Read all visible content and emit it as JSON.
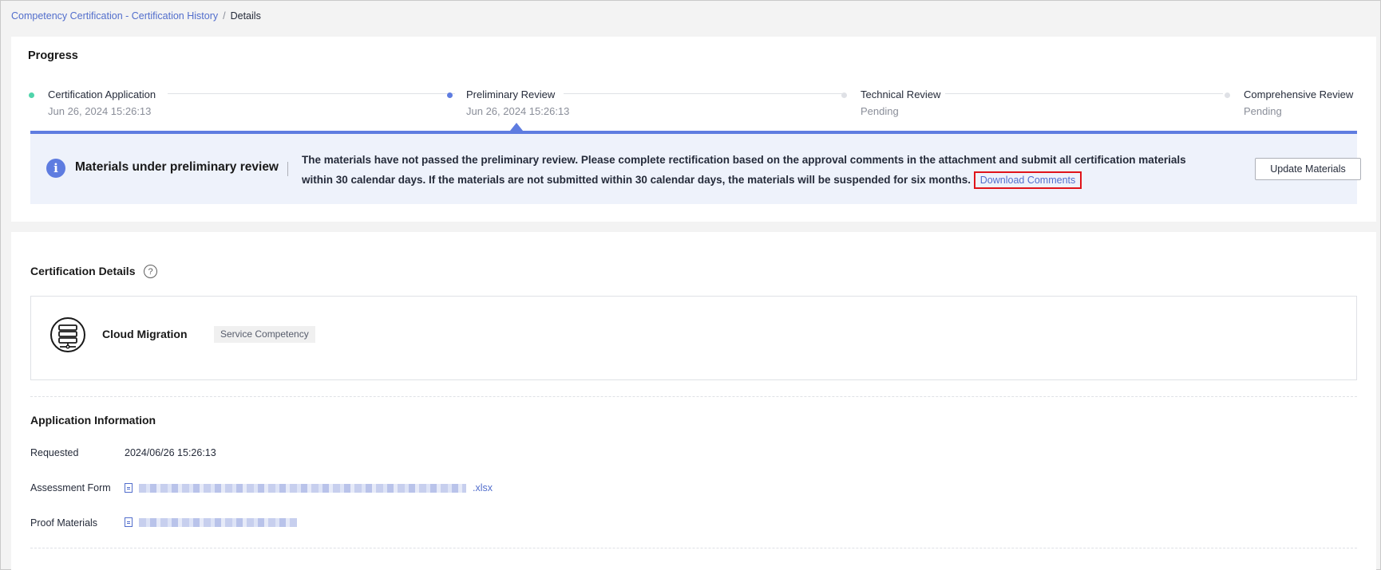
{
  "breadcrumb": {
    "parent": "Competency Certification - Certification History",
    "separator": "/",
    "current": "Details"
  },
  "progress": {
    "title": "Progress",
    "steps": [
      {
        "label": "Certification Application",
        "sub": "Jun 26, 2024 15:26:13",
        "status": "done"
      },
      {
        "label": "Preliminary Review",
        "sub": "Jun 26, 2024 15:26:13",
        "status": "current"
      },
      {
        "label": "Technical Review",
        "sub": "Pending",
        "status": "pending"
      },
      {
        "label": "Comprehensive Review",
        "sub": "Pending",
        "status": "pending"
      }
    ]
  },
  "notice": {
    "title": "Materials under preliminary review",
    "message": "The materials have not passed the preliminary review. Please complete rectification based on the approval comments in the attachment and submit all certification materials within 30 calendar days. If the materials are not submitted within 30 calendar days, the materials will be suspended for six months.",
    "link_label": "Download Comments",
    "button_label": "Update Materials"
  },
  "details": {
    "title": "Certification Details",
    "help_icon": "?",
    "competency_name": "Cloud Migration",
    "competency_tag": "Service Competency"
  },
  "application": {
    "title": "Application Information",
    "requested_label": "Requested",
    "requested_value": "2024/06/26 15:26:13",
    "assessment_label": "Assessment Form",
    "assessment_ext": ".xlsx",
    "proof_label": "Proof Materials"
  },
  "colors": {
    "done": "#50d4ab",
    "current": "#5e7ce0",
    "pending": "#dfe1e6",
    "accent": "#5e7ce0",
    "link": "#526ecc",
    "highlight": "#e0141a"
  }
}
